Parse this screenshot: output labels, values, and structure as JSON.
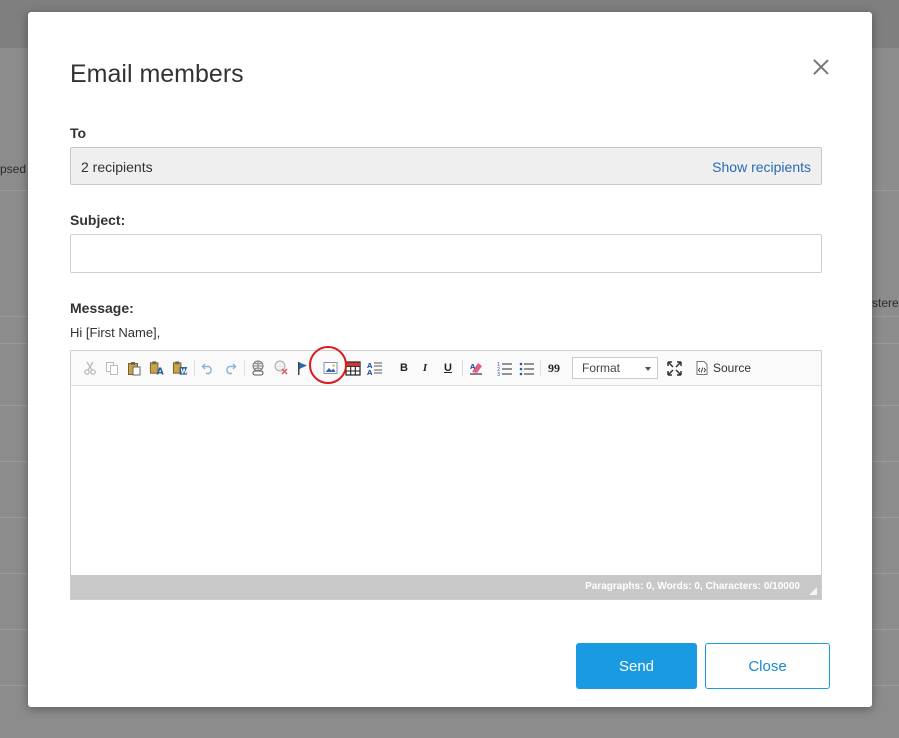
{
  "background": {
    "left_fragment": "psed",
    "right_fragment": "stere"
  },
  "modal": {
    "title": "Email members",
    "to_label": "To",
    "to_value": "2 recipients",
    "show_recipients": "Show recipients",
    "subject_label": "Subject:",
    "subject_value": "",
    "message_label": "Message:",
    "greeting": "Hi [First Name],",
    "editor": {
      "toolbar": {
        "icons": [
          "cut-icon",
          "copy-icon",
          "paste-icon",
          "paste-text-icon",
          "paste-word-icon",
          "undo-icon",
          "redo-icon",
          "link-icon",
          "unlink-icon",
          "anchor-icon",
          "image-icon",
          "table-icon",
          "special-char-icon",
          "bold-icon",
          "italic-icon",
          "underline-icon",
          "remove-format-icon",
          "numbered-list-icon",
          "bulleted-list-icon",
          "blockquote-icon",
          "maximize-icon",
          "source-icon"
        ],
        "bold_glyph": "B",
        "italic_glyph": "I",
        "underline_glyph": "U",
        "quote_glyph": "99",
        "format_label": "Format",
        "source_label": "Source"
      },
      "status": "Paragraphs: 0, Words: 0, Characters: 0/10000"
    },
    "send_label": "Send",
    "close_label": "Close"
  },
  "colors": {
    "accent": "#1a9ae0",
    "link": "#2a6ab5",
    "highlight": "#d81b1b"
  }
}
